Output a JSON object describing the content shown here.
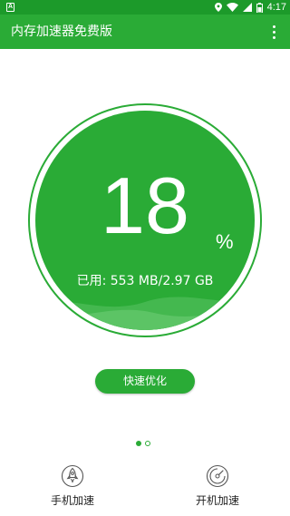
{
  "status_bar": {
    "time": "4:17",
    "left_icon": "A",
    "icons": [
      "location-icon",
      "wifi-icon",
      "signal-icon",
      "battery-icon"
    ]
  },
  "app_bar": {
    "title": "内存加速器免费版",
    "menu_icon": "more-vert-icon"
  },
  "memory": {
    "percent": "18",
    "percent_sign": "%",
    "usage_text": "已用: 553 MB/2.97 GB",
    "used_fraction": 0.18
  },
  "optimize_button": {
    "label": "快速优化"
  },
  "pager": {
    "pages": 2,
    "active": 0
  },
  "bottom_actions": [
    {
      "label": "手机加速",
      "icon": "rocket-icon"
    },
    {
      "label": "开机加速",
      "icon": "disc-speed-icon"
    }
  ],
  "colors": {
    "primary": "#2aab36",
    "status_bar": "#1c9a2a",
    "gauge_ring": "#2aab36",
    "wave": "#4fbc59"
  }
}
